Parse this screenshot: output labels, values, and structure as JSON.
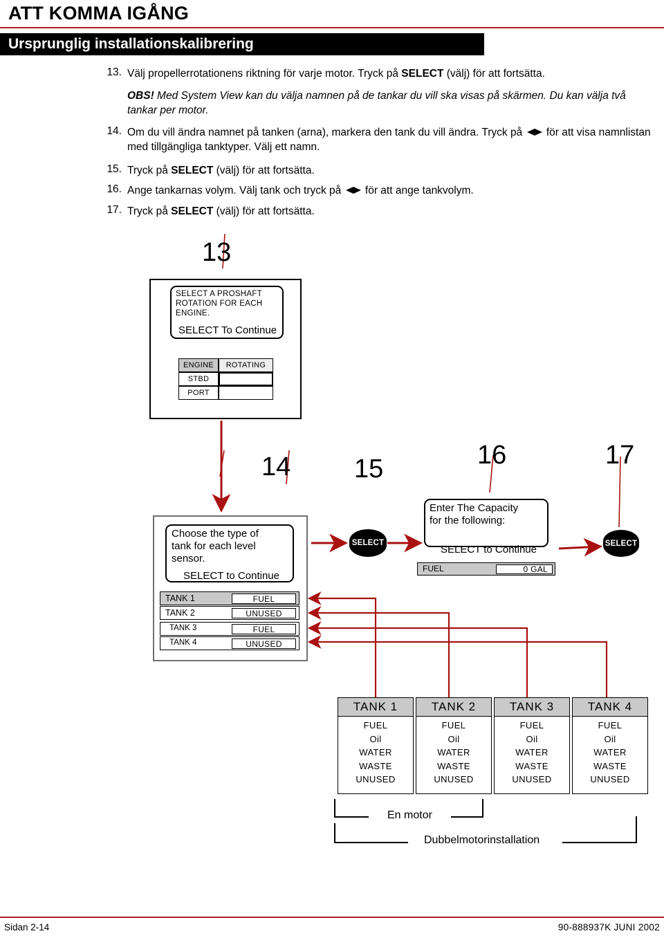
{
  "header": {
    "title": "ATT KOMMA IGÅNG",
    "section": "Ursprunglig installationskalibrering",
    "rule_color": "#b01c26",
    "bar_color": "#000000"
  },
  "steps": [
    {
      "num": "13.",
      "text_before": "Välj propellerrotationens riktning för varje motor. Tryck på ",
      "kbd": "SELECT",
      "text_after": " (välj) för att fortsätta."
    },
    {
      "num": "15.",
      "text_before": "Tryck på ",
      "kbd": "SELECT",
      "text_after": " (välj) för att fortsätta."
    },
    {
      "num": "17.",
      "text_before": "Tryck på ",
      "kbd": "SELECT",
      "text_after": " (välj) för att fortsätta."
    }
  ],
  "note": {
    "label": "OBS!",
    "text": " Med System View kan du välja namnen på de tankar du vill ska visas på skärmen. Du kan välja två tankar per motor."
  },
  "step14": {
    "num": "14.",
    "part1": "Om du vill ändra namnet på tanken (arna), markera den tank du vill ändra. Tryck på ",
    "part2": " för att visa namnlistan med tillgängliga tanktyper. Välj ett namn."
  },
  "step16": {
    "num": "16.",
    "part1": "Ange tankarnas volym. Välj tank och tryck på ",
    "part2": " för att ange tankvolym."
  },
  "callouts": {
    "n13": "13",
    "n14": "14",
    "n15": "15",
    "n16": "16",
    "n17": "17"
  },
  "screen13": {
    "message_line1": "SELECT  A  PROSHAFT",
    "message_line2": "ROTATION FOR EACH",
    "message_line3": "ENGINE.",
    "message_continue": "SELECT  To  Continue",
    "table": {
      "col1_header": "ENGINE",
      "col2_header": "ROTATING",
      "rows": [
        {
          "engine": "STBD",
          "rotating": ""
        },
        {
          "engine": "PORT",
          "rotating": ""
        }
      ]
    }
  },
  "screen14": {
    "message_line1": "Choose the type of",
    "message_line2": "tank for each level",
    "message_line3": "sensor.",
    "message_continue": "SELECT to Continue",
    "rows": [
      {
        "label": "TANK  1",
        "value": "FUEL",
        "highlighted": true
      },
      {
        "label": "TANK  2",
        "value": "UNUSED",
        "highlighted": false
      },
      {
        "label": "TANK 3",
        "value": "FUEL",
        "highlighted": false
      },
      {
        "label": "TANK 4",
        "value": "UNUSED",
        "highlighted": false
      }
    ]
  },
  "screen16": {
    "message_line1": "Enter The Capacity",
    "message_line2": "for the following:",
    "message_continue": "SELECT to Continue",
    "field_label": "FUEL",
    "field_value": "0  GAL"
  },
  "select_buttons": {
    "label": "SELECT"
  },
  "tank_options": {
    "columns": [
      {
        "title": "TANK  1",
        "options": [
          "FUEL",
          "Oil",
          "WATER",
          "WASTE",
          "UNUSED"
        ]
      },
      {
        "title": "TANK  2",
        "options": [
          "FUEL",
          "Oil",
          "WATER",
          "WASTE",
          "UNUSED"
        ]
      },
      {
        "title": "TANK 3",
        "options": [
          "FUEL",
          "Oil",
          "WATER",
          "WASTE",
          "UNUSED"
        ]
      },
      {
        "title": "TANK 4",
        "options": [
          "FUEL",
          "Oil",
          "WATER",
          "WASTE",
          "UNUSED"
        ]
      }
    ]
  },
  "brackets": {
    "single": "En motor",
    "dual": "Dubbelmotorinstallation"
  },
  "footer": {
    "left": "Sidan 2-14",
    "right": "90-888937K   JUNI  2002"
  },
  "colors": {
    "accent_red": "#b01c26",
    "arrow_red": "#aa1111",
    "grey_fill": "#c9c9c9"
  }
}
